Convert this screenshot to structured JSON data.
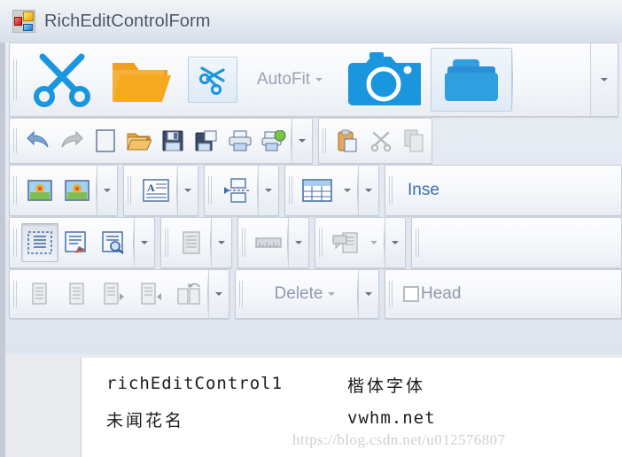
{
  "window": {
    "title": "RichEditControlForm",
    "icon": "winforms-app-icon"
  },
  "colors": {
    "accent_blue": "#1a96de",
    "folder_orange": "#f0a020",
    "title_text": "#4a5668",
    "disabled_gray": "#a9b0bb",
    "watermark": "#cfcfcf"
  },
  "toolbars": [
    {
      "name": "row-1",
      "groups": [
        {
          "name": "clipboard-large-group",
          "items": [
            {
              "name": "cut-large-button",
              "icon": "scissors-icon",
              "label": "",
              "state": "normal"
            },
            {
              "name": "open-folder-large-button",
              "icon": "folder-open-icon",
              "label": "",
              "state": "normal"
            },
            {
              "name": "cut-small-button",
              "icon": "scissors-small-icon",
              "label": "",
              "state": "selected"
            },
            {
              "name": "autofit-button",
              "icon": "",
              "label": "AutoFit",
              "state": "dropdown"
            },
            {
              "name": "camera-button",
              "icon": "camera-icon",
              "label": "",
              "state": "normal"
            },
            {
              "name": "folder-blue-button",
              "icon": "folder-blue-icon",
              "label": "",
              "state": "selected"
            }
          ],
          "overflow": "chevron-down-icon"
        }
      ]
    },
    {
      "name": "row-2",
      "groups": [
        {
          "name": "standard-group",
          "items": [
            {
              "name": "undo-button",
              "icon": "undo-arrow-icon",
              "label": "",
              "state": "normal"
            },
            {
              "name": "redo-button",
              "icon": "redo-arrow-icon",
              "label": "",
              "state": "disabled"
            },
            {
              "name": "new-document-button",
              "icon": "new-document-icon",
              "label": "",
              "state": "normal"
            },
            {
              "name": "open-document-button",
              "icon": "folder-open-icon",
              "label": "",
              "state": "normal"
            },
            {
              "name": "save-button",
              "icon": "floppy-disk-icon",
              "label": "",
              "state": "normal"
            },
            {
              "name": "save-as-button",
              "icon": "save-as-icon",
              "label": "",
              "state": "normal"
            },
            {
              "name": "print-button",
              "icon": "printer-icon",
              "label": "",
              "state": "normal"
            },
            {
              "name": "print-preview-button",
              "icon": "print-preview-icon",
              "label": "",
              "state": "normal"
            }
          ],
          "overflow": "chevron-down-icon"
        },
        {
          "name": "clipboard-group",
          "items": [
            {
              "name": "paste-button",
              "icon": "clipboard-paste-icon",
              "label": "",
              "state": "normal"
            },
            {
              "name": "cut-button",
              "icon": "scissors-gray-icon",
              "label": "",
              "state": "disabled"
            },
            {
              "name": "copy-button",
              "icon": "copy-pages-icon",
              "label": "",
              "state": "disabled"
            }
          ],
          "overflow": ""
        }
      ]
    },
    {
      "name": "row-3",
      "groups": [
        {
          "name": "illustrations-group",
          "items": [
            {
              "name": "insert-picture-button",
              "icon": "picture-flower-icon",
              "label": "",
              "state": "normal"
            },
            {
              "name": "insert-picture-floating-button",
              "icon": "picture-flower-icon",
              "label": "",
              "state": "normal"
            }
          ],
          "overflow": "chevron-down-icon"
        },
        {
          "name": "textbox-group",
          "items": [
            {
              "name": "insert-textbox-button",
              "icon": "textbox-a-icon",
              "label": "",
              "state": "normal"
            }
          ],
          "overflow": "chevron-down-icon"
        },
        {
          "name": "page-break-group",
          "items": [
            {
              "name": "insert-page-break-button",
              "icon": "page-break-icon",
              "label": "",
              "state": "normal"
            }
          ],
          "overflow": "chevron-down-icon"
        },
        {
          "name": "table-group",
          "items": [
            {
              "name": "insert-table-button",
              "icon": "table-grid-icon",
              "label": "",
              "state": "dropdown"
            }
          ],
          "overflow": "chevron-down-icon"
        },
        {
          "name": "insert-group",
          "items": [
            {
              "name": "insert-label",
              "icon": "",
              "label": "Inse",
              "state": "text"
            }
          ],
          "overflow": ""
        }
      ]
    },
    {
      "name": "row-4",
      "groups": [
        {
          "name": "view-group",
          "items": [
            {
              "name": "print-layout-view-button",
              "icon": "page-layout-icon",
              "label": "",
              "state": "pressed"
            },
            {
              "name": "draft-view-button",
              "icon": "draft-pencil-icon",
              "label": "",
              "state": "normal"
            },
            {
              "name": "print-preview-view-button",
              "icon": "page-magnifier-icon",
              "label": "",
              "state": "normal"
            }
          ],
          "overflow": "chevron-down-icon"
        },
        {
          "name": "document-view-group",
          "items": [
            {
              "name": "simple-view-button",
              "icon": "gray-document-icon",
              "label": "",
              "state": "disabled"
            }
          ],
          "overflow": "chevron-down-icon"
        },
        {
          "name": "ruler-group",
          "items": [
            {
              "name": "show-ruler-button",
              "icon": "ruler-icon",
              "label": "",
              "state": "disabled"
            }
          ],
          "overflow": "chevron-down-icon"
        },
        {
          "name": "comments-group",
          "items": [
            {
              "name": "show-comments-button",
              "icon": "comment-callout-icon",
              "label": "",
              "state": "dropdown-disabled"
            }
          ],
          "overflow": "chevron-down-icon"
        }
      ]
    },
    {
      "name": "row-5",
      "groups": [
        {
          "name": "page-navigation-group",
          "items": [
            {
              "name": "page-first-button",
              "icon": "gray-document-icon",
              "label": "",
              "state": "disabled"
            },
            {
              "name": "page-prev-button",
              "icon": "gray-document-icon",
              "label": "",
              "state": "disabled"
            },
            {
              "name": "page-next-button",
              "icon": "gray-document-right-icon",
              "label": "",
              "state": "disabled"
            },
            {
              "name": "page-last-button",
              "icon": "gray-document-left-icon",
              "label": "",
              "state": "disabled"
            },
            {
              "name": "page-restore-button",
              "icon": "gray-documents-undo-icon",
              "label": "",
              "state": "disabled"
            }
          ],
          "overflow": "chevron-down-icon"
        },
        {
          "name": "delete-group",
          "items": [
            {
              "name": "delete-button",
              "icon": "",
              "label": "Delete",
              "state": "dropdown-disabled"
            }
          ],
          "overflow": "chevron-down-icon"
        },
        {
          "name": "header-group",
          "items": [
            {
              "name": "header-checkbox",
              "icon": "checkbox-unchecked-icon",
              "label": "Head",
              "state": "disabled"
            }
          ],
          "overflow": ""
        }
      ]
    }
  ],
  "document": {
    "name": "rich-edit-document",
    "lines": [
      {
        "left": "richEditControl1",
        "right": "楷体字体"
      },
      {
        "left": "未闻花名",
        "right": "vwhm.net"
      }
    ]
  },
  "watermark": {
    "text": "https://blog.csdn.net/u012576807"
  }
}
